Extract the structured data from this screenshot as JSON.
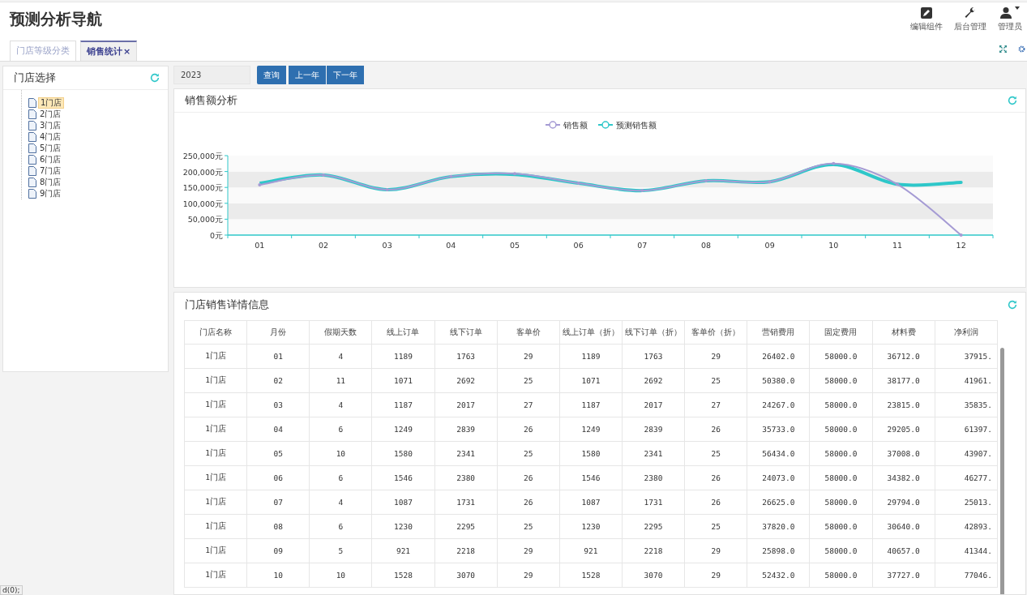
{
  "header": {
    "title": "预测分析导航",
    "actions": [
      {
        "kind": "edit",
        "label": "编辑组件"
      },
      {
        "kind": "wrench",
        "label": "后台管理"
      },
      {
        "kind": "user",
        "label": "管理员"
      }
    ]
  },
  "tabs": [
    {
      "label": "门店等级分类",
      "selected": false,
      "closable": false
    },
    {
      "label": "销售统计",
      "selected": true,
      "closable": true,
      "close": "×"
    }
  ],
  "store_panel": {
    "title": "门店选择",
    "items": [
      {
        "label": "1门店",
        "selected": true
      },
      {
        "label": "2门店",
        "selected": false
      },
      {
        "label": "3门店",
        "selected": false
      },
      {
        "label": "4门店",
        "selected": false
      },
      {
        "label": "5门店",
        "selected": false
      },
      {
        "label": "6门店",
        "selected": false
      },
      {
        "label": "7门店",
        "selected": false
      },
      {
        "label": "8门店",
        "selected": false
      },
      {
        "label": "9门店",
        "selected": false
      }
    ]
  },
  "toolbar": {
    "year": "2023",
    "buttons": [
      "查询",
      "上一年",
      "下一年"
    ]
  },
  "chart_panel": {
    "title": "销售额分析",
    "chart_data": {
      "type": "line",
      "legend": "top",
      "categories": [
        "01",
        "02",
        "03",
        "04",
        "05",
        "06",
        "07",
        "08",
        "09",
        "10",
        "11",
        "12"
      ],
      "ylim": [
        0,
        250000
      ],
      "yticks": [
        {
          "value": 0,
          "label": "0元"
        },
        {
          "value": 50000,
          "label": "50,000元"
        },
        {
          "value": 100000,
          "label": "100,000元"
        },
        {
          "value": 150000,
          "label": "150,000元"
        },
        {
          "value": 200000,
          "label": "200,000元"
        },
        {
          "value": 250000,
          "label": "250,000元"
        }
      ],
      "series": [
        {
          "name": "销售额",
          "color": "#a59bd4",
          "values": [
            158000,
            189000,
            143000,
            184000,
            193000,
            163000,
            140000,
            171000,
            168000,
            225000,
            160000,
            0
          ]
        },
        {
          "name": "预测销售额",
          "color": "#2ec7c9",
          "values": [
            163000,
            189000,
            143000,
            184000,
            191000,
            163000,
            140000,
            171000,
            168000,
            222000,
            160000,
            166000
          ]
        }
      ]
    }
  },
  "table_panel": {
    "title": "门店销售详情信息",
    "columns": [
      "门店名称",
      "月份",
      "假期天数",
      "线上订单",
      "线下订单",
      "客单价",
      "线上订单（折）",
      "线下订单（折）",
      "客单价（折）",
      "营销费用",
      "固定费用",
      "材料费",
      "净利润"
    ],
    "rows": [
      [
        "1门店",
        "01",
        "4",
        "1189",
        "1763",
        "29",
        "1189",
        "1763",
        "29",
        "26402.0",
        "58000.0",
        "36712.0",
        "37915."
      ],
      [
        "1门店",
        "02",
        "11",
        "1071",
        "2692",
        "25",
        "1071",
        "2692",
        "25",
        "50380.0",
        "58000.0",
        "38177.0",
        "41961."
      ],
      [
        "1门店",
        "03",
        "4",
        "1187",
        "2017",
        "27",
        "1187",
        "2017",
        "27",
        "24267.0",
        "58000.0",
        "23815.0",
        "35835."
      ],
      [
        "1门店",
        "04",
        "6",
        "1249",
        "2839",
        "26",
        "1249",
        "2839",
        "26",
        "35733.0",
        "58000.0",
        "29205.0",
        "61397."
      ],
      [
        "1门店",
        "05",
        "10",
        "1580",
        "2341",
        "25",
        "1580",
        "2341",
        "25",
        "56434.0",
        "58000.0",
        "37008.0",
        "43907."
      ],
      [
        "1门店",
        "06",
        "6",
        "1546",
        "2380",
        "26",
        "1546",
        "2380",
        "26",
        "24073.0",
        "58000.0",
        "34382.0",
        "46277."
      ],
      [
        "1门店",
        "07",
        "4",
        "1087",
        "1731",
        "26",
        "1087",
        "1731",
        "26",
        "26625.0",
        "58000.0",
        "29794.0",
        "25013."
      ],
      [
        "1门店",
        "08",
        "6",
        "1230",
        "2295",
        "25",
        "1230",
        "2295",
        "25",
        "37820.0",
        "58000.0",
        "30640.0",
        "42893."
      ],
      [
        "1门店",
        "09",
        "5",
        "921",
        "2218",
        "29",
        "921",
        "2218",
        "29",
        "25898.0",
        "58000.0",
        "40657.0",
        "41344."
      ],
      [
        "1门店",
        "10",
        "10",
        "1528",
        "3070",
        "29",
        "1528",
        "3070",
        "29",
        "52432.0",
        "58000.0",
        "37727.0",
        "77046."
      ]
    ]
  },
  "status_text": "d(0);"
}
